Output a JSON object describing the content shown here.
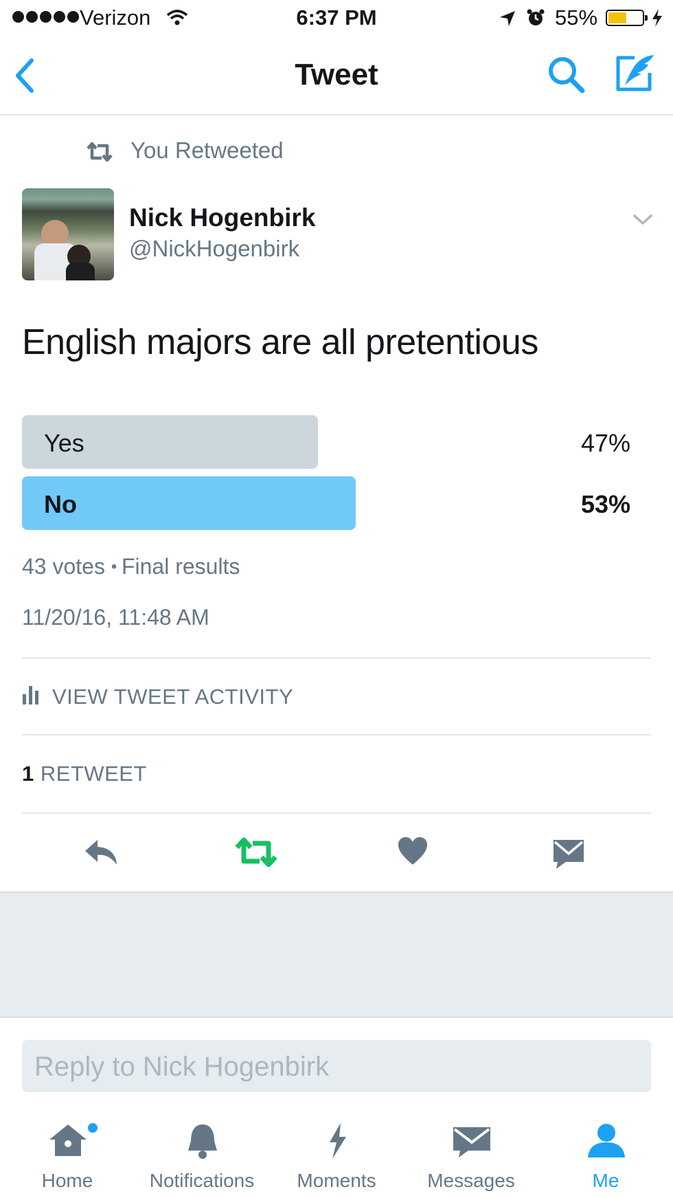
{
  "status_bar": {
    "carrier": "Verizon",
    "time": "6:37 PM",
    "battery": "55%",
    "battery_level": 0.55
  },
  "nav": {
    "title": "Tweet"
  },
  "tweet": {
    "retweet_context": "You Retweeted",
    "author_name": "Nick Hogenbirk",
    "author_handle": "@NickHogenbirk",
    "text": "English majors are all pretentious",
    "poll": {
      "options": [
        {
          "label": "Yes",
          "percent": "47%",
          "value": 47,
          "color": "#ccd6dd"
        },
        {
          "label": "No",
          "percent": "53%",
          "value": 53,
          "color": "#71c9f8"
        }
      ],
      "votes": "43 votes",
      "status": "Final results"
    },
    "timestamp": "11/20/16, 11:48 AM",
    "activity_label": "VIEW TWEET ACTIVITY",
    "retweet_count": "1",
    "retweet_label": "RETWEET"
  },
  "reply": {
    "placeholder": "Reply to Nick Hogenbirk"
  },
  "tabs": [
    {
      "label": "Home",
      "icon": "home-icon",
      "active": false
    },
    {
      "label": "Notifications",
      "icon": "bell-icon",
      "active": false
    },
    {
      "label": "Moments",
      "icon": "lightning-icon",
      "active": false
    },
    {
      "label": "Messages",
      "icon": "envelope-icon",
      "active": false
    },
    {
      "label": "Me",
      "icon": "person-icon",
      "active": true
    }
  ],
  "colors": {
    "accent": "#1da1f2",
    "retweet_green": "#17bf63",
    "muted": "#657786"
  }
}
